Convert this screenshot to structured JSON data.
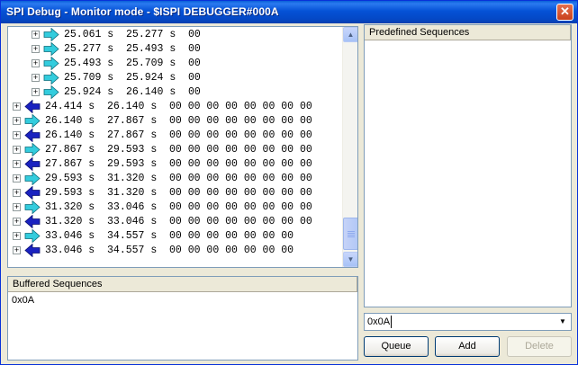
{
  "window": {
    "title": "SPI Debug - Monitor mode - $ISPI DEBUGGER#000A"
  },
  "tree": {
    "rows": [
      {
        "indent": 1,
        "dir": "out",
        "start": "25.061 s",
        "end": "25.277 s",
        "data": "00"
      },
      {
        "indent": 1,
        "dir": "out",
        "start": "25.277 s",
        "end": "25.493 s",
        "data": "00"
      },
      {
        "indent": 1,
        "dir": "out",
        "start": "25.493 s",
        "end": "25.709 s",
        "data": "00"
      },
      {
        "indent": 1,
        "dir": "out",
        "start": "25.709 s",
        "end": "25.924 s",
        "data": "00"
      },
      {
        "indent": 1,
        "dir": "out",
        "start": "25.924 s",
        "end": "26.140 s",
        "data": "00"
      },
      {
        "indent": 0,
        "dir": "in",
        "start": "24.414 s",
        "end": "26.140 s",
        "data": "00 00 00 00 00 00 00 00"
      },
      {
        "indent": 0,
        "dir": "out",
        "start": "26.140 s",
        "end": "27.867 s",
        "data": "00 00 00 00 00 00 00 00"
      },
      {
        "indent": 0,
        "dir": "in",
        "start": "26.140 s",
        "end": "27.867 s",
        "data": "00 00 00 00 00 00 00 00"
      },
      {
        "indent": 0,
        "dir": "out",
        "start": "27.867 s",
        "end": "29.593 s",
        "data": "00 00 00 00 00 00 00 00"
      },
      {
        "indent": 0,
        "dir": "in",
        "start": "27.867 s",
        "end": "29.593 s",
        "data": "00 00 00 00 00 00 00 00"
      },
      {
        "indent": 0,
        "dir": "out",
        "start": "29.593 s",
        "end": "31.320 s",
        "data": "00 00 00 00 00 00 00 00"
      },
      {
        "indent": 0,
        "dir": "in",
        "start": "29.593 s",
        "end": "31.320 s",
        "data": "00 00 00 00 00 00 00 00"
      },
      {
        "indent": 0,
        "dir": "out",
        "start": "31.320 s",
        "end": "33.046 s",
        "data": "00 00 00 00 00 00 00 00"
      },
      {
        "indent": 0,
        "dir": "in",
        "start": "31.320 s",
        "end": "33.046 s",
        "data": "00 00 00 00 00 00 00 00"
      },
      {
        "indent": 0,
        "dir": "out",
        "start": "33.046 s",
        "end": "34.557 s",
        "data": "00 00 00 00 00 00 00"
      },
      {
        "indent": 0,
        "dir": "in",
        "start": "33.046 s",
        "end": "34.557 s",
        "data": "00 00 00 00 00 00 00"
      }
    ],
    "icons": {
      "expand": "plus-box-icon",
      "out": "cyan-right-arrow-icon",
      "in": "blue-left-arrow-icon"
    }
  },
  "buffered": {
    "header": "Buffered Sequences",
    "items": [
      "0x0A"
    ]
  },
  "predefined": {
    "header": "Predefined Sequences"
  },
  "sequence_input": {
    "value": "0x0A"
  },
  "buttons": {
    "queue": "Queue",
    "add": "Add",
    "delete": "Delete"
  },
  "colors": {
    "title_bar": "#0552d6",
    "out_arrow": "#33ccdd",
    "in_arrow": "#1a22c0",
    "panel_border": "#7f9db9"
  }
}
